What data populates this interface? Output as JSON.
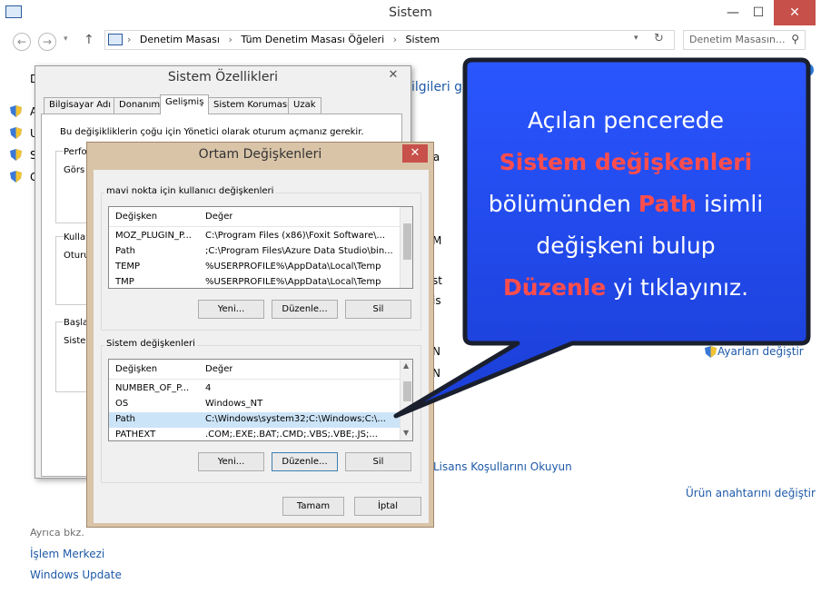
{
  "window": {
    "title": "Sistem",
    "minimize": "—",
    "maximize": "☐",
    "close": "✕"
  },
  "address": {
    "crumb1": "Denetim Masası",
    "crumb2": "Tüm Denetim Masası Öğeleri",
    "crumb3": "Sistem",
    "sep": "›",
    "search_placeholder": "Denetim Masasın..."
  },
  "background": {
    "frag_left": [
      "D",
      "A",
      "U",
      "S",
      "G"
    ],
    "frag_top": "ilgileri gö",
    "frag_right": [
      "ra",
      "M",
      "st",
      "is",
      "N",
      "N"
    ],
    "right_fragments": [
      "Ayarları değiştir"
    ],
    "license": "Lisans Koşullarını Okuyun",
    "product_key": "Ürün anahtarını değiştir",
    "see_also": "Ayrıca bkz.",
    "action_center": "İşlem Merkezi",
    "windows_update": "Windows Update"
  },
  "sys_props": {
    "title": "Sistem Özellikleri",
    "close": "✕",
    "tabs": [
      "Bilgisayar Adı",
      "Donanım",
      "Gelişmiş",
      "Sistem Koruması",
      "Uzak"
    ],
    "admin_note": "Bu değişikliklerin çoğu için Yönetici olarak oturum açmanız gerekir.",
    "group1_label": "Perfo",
    "group1_sub": "Görs",
    "group2_label": "Kulla",
    "group2_sub": "Oturu",
    "group3_label": "Başla",
    "group3_sub": "Siste"
  },
  "env": {
    "title": "Ortam Değişkenleri",
    "close": "✕",
    "user_group": "mavi nokta için kullanıcı değişkenleri",
    "col_var": "Değişken",
    "col_val": "Değer",
    "user_rows": [
      {
        "name": "MOZ_PLUGIN_P...",
        "value": "C:\\Program Files (x86)\\Foxit Software\\..."
      },
      {
        "name": "Path",
        "value": ";C:\\Program Files\\Azure Data Studio\\bin..."
      },
      {
        "name": "TEMP",
        "value": "%USERPROFILE%\\AppData\\Local\\Temp"
      },
      {
        "name": "TMP",
        "value": "%USERPROFILE%\\AppData\\Local\\Temp"
      }
    ],
    "sys_group": "Sistem değişkenleri",
    "sys_rows": [
      {
        "name": "NUMBER_OF_P...",
        "value": "4"
      },
      {
        "name": "OS",
        "value": "Windows_NT"
      },
      {
        "name": "Path",
        "value": "C:\\Windows\\system32;C:\\Windows;C:\\..."
      },
      {
        "name": "PATHEXT",
        "value": ".COM;.EXE;.BAT;.CMD;.VBS;.VBE;.JS;..."
      }
    ],
    "btn_new": "Yeni...",
    "btn_edit": "Düzenle...",
    "btn_delete": "Sil",
    "btn_ok": "Tamam",
    "btn_cancel": "İptal"
  },
  "callout": {
    "line1": "Açılan pencerede",
    "line2": "Sistem değişkenleri",
    "line3_a": "bölümünden ",
    "line3_b": "Path",
    "line3_c": " isimli",
    "line4": "değişkeni bulup",
    "line5_a": "Düzenle",
    "line5_b": " yi tıklayınız."
  },
  "colors": {
    "callout_fill": "#1f47e6",
    "callout_stroke": "#1a1f2e",
    "highlight_red": "#ff4d4d",
    "link_blue": "#1e5aa8",
    "env_border": "#d9c4a8",
    "close_red": "#c7504b"
  }
}
